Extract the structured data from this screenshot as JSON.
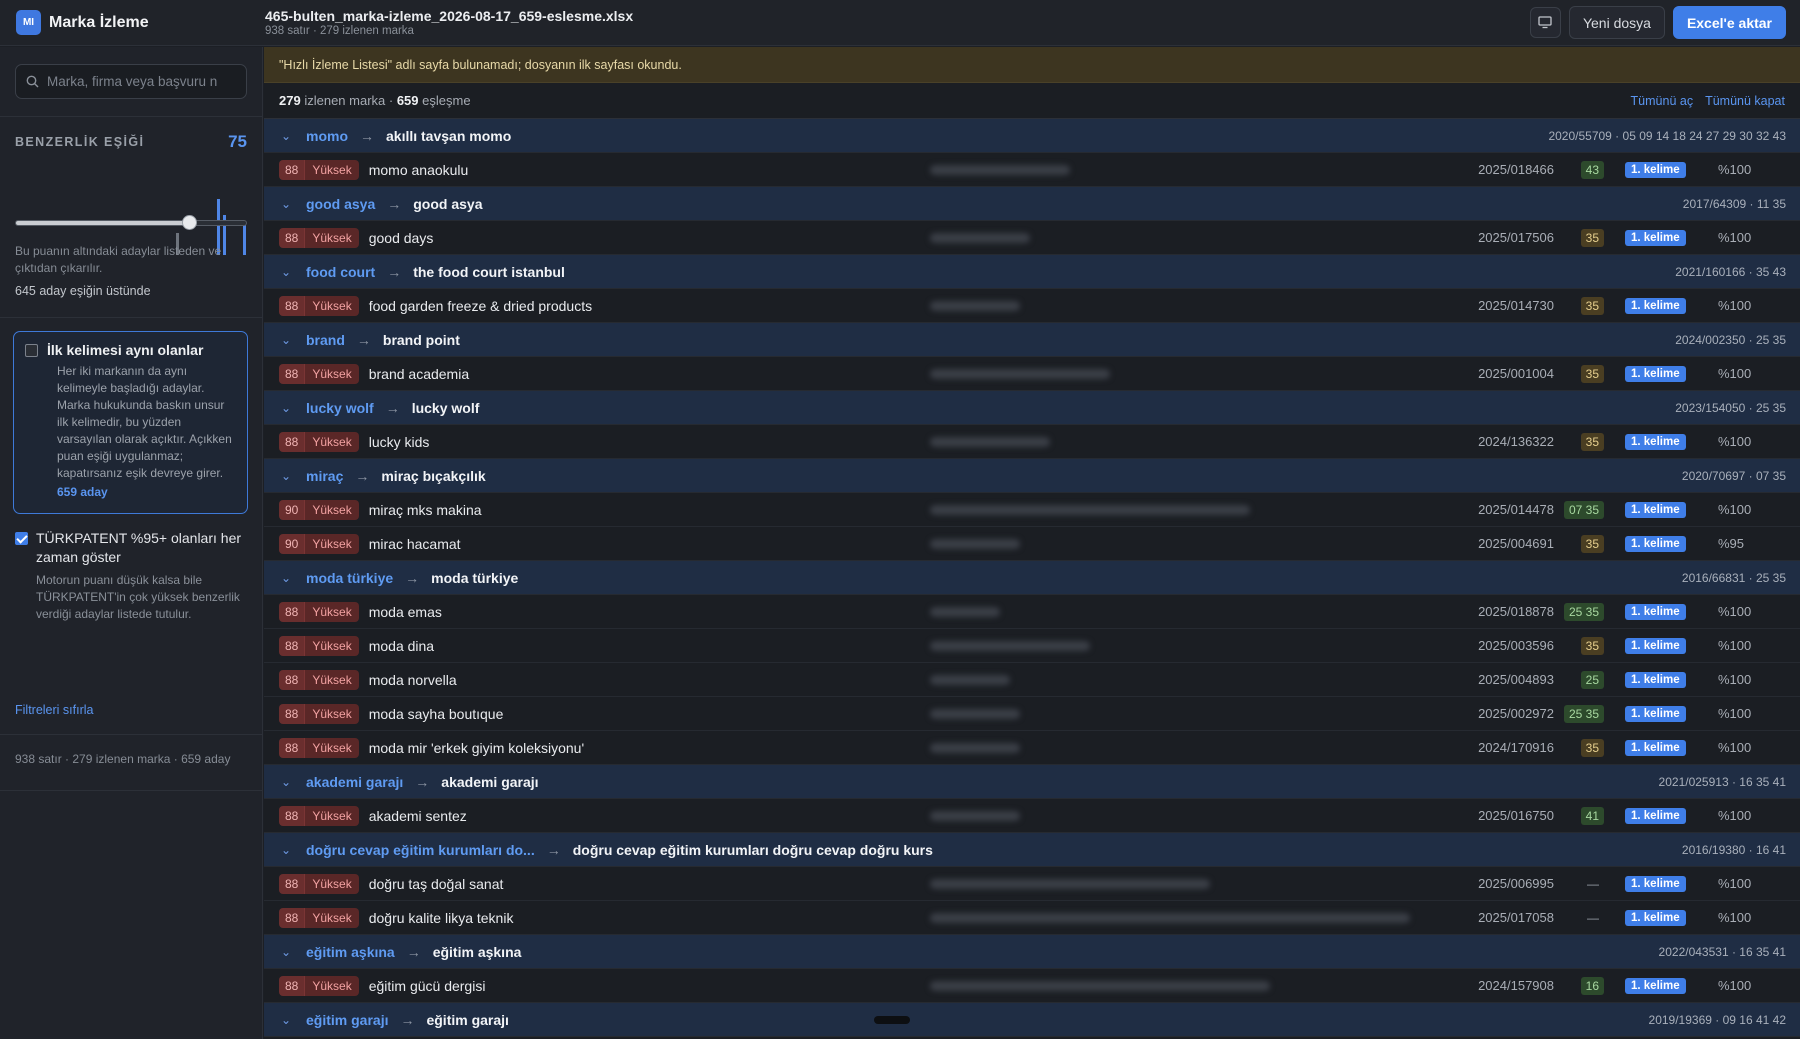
{
  "app": {
    "badge": "MI",
    "title": "Marka İzleme"
  },
  "file": {
    "name": "465-bulten_marka-izleme_2026-08-17_659-eslesme.xlsx",
    "meta": "938 satır · 279 izlenen marka"
  },
  "toolbar": {
    "new_file": "Yeni dosya",
    "export": "Excel'e aktar"
  },
  "sidebar": {
    "search_placeholder": "Marka, firma veya başvuru n",
    "threshold_label": "BENZERLİK EŞİĞİ",
    "threshold_value": "75",
    "threshold_level": 75,
    "help_text": "Bu puanın altındaki adaylar listeden ve çıktıdan çıkarılır.",
    "above_threshold": "645 aday eşiğin üstünde",
    "first_word": {
      "title": "İlk kelimesi aynı olanlar",
      "desc": "Her iki markanın da aynı kelimeyle başladığı adaylar. Marka hukukunda baskın unsur ilk kelimedir, bu yüzden varsayılan olarak açıktır. Açıkken puan eşiği uygulanmaz; kapatırsanız eşik devreye girer.",
      "count": "659 aday",
      "checked": false
    },
    "turkpatent": {
      "title": "TÜRKPATENT %95+ olanları her zaman göster",
      "desc": "Motorun puanı düşük kalsa bile TÜRKPATENT'in çok yüksek benzerlik verdiği adaylar listede tutulur.",
      "checked": true
    },
    "reset": "Filtreleri sıfırla",
    "footer": "938 satır · 279 izlenen marka · 659 aday"
  },
  "main": {
    "banner": "\"Hızlı İzleme Listesi\" adlı sayfa bulunamadı; dosyanın ilk sayfası okundu.",
    "summary": {
      "watched_count": "279",
      "watched_label": "izlenen marka ·",
      "match_count": "659",
      "match_label": "eşleşme"
    },
    "expand_all": "Tümünü aç",
    "collapse_all": "Tümünü kapat",
    "level_label": "Yüksek",
    "word_badge": "1. kelime",
    "groups": [
      {
        "source": "momo",
        "target": "akıllı tavşan momo",
        "meta": "2020/55709 · 05 09 14 18 24 27 29 30 32 43",
        "candidates": [
          {
            "score": "88",
            "name": "momo anaokulu",
            "app": "2025/018466",
            "cls": "43",
            "cls_color": "green",
            "pct": "%100"
          }
        ]
      },
      {
        "source": "good asya",
        "target": "good asya",
        "meta": "2017/64309 · 11 35",
        "candidates": [
          {
            "score": "88",
            "name": "good days",
            "app": "2025/017506",
            "cls": "35",
            "cls_color": "amber",
            "pct": "%100"
          }
        ]
      },
      {
        "source": "food court",
        "target": "the food court istanbul",
        "meta": "2021/160166 · 35 43",
        "candidates": [
          {
            "score": "88",
            "name": "food garden freeze & dried products",
            "app": "2025/014730",
            "cls": "35",
            "cls_color": "amber",
            "pct": "%100"
          }
        ]
      },
      {
        "source": "brand",
        "target": "brand point",
        "meta": "2024/002350 · 25 35",
        "candidates": [
          {
            "score": "88",
            "name": "brand academia",
            "app": "2025/001004",
            "cls": "35",
            "cls_color": "amber",
            "pct": "%100"
          }
        ]
      },
      {
        "source": "lucky wolf",
        "target": "lucky wolf",
        "meta": "2023/154050 · 25 35",
        "candidates": [
          {
            "score": "88",
            "name": "lucky kids",
            "app": "2024/136322",
            "cls": "35",
            "cls_color": "amber",
            "pct": "%100"
          }
        ]
      },
      {
        "source": "miraç",
        "target": "miraç bıçakçılık",
        "meta": "2020/70697 · 07 35",
        "candidates": [
          {
            "score": "90",
            "name": "miraç mks makina",
            "app": "2025/014478",
            "cls": "07 35",
            "cls_color": "green",
            "pct": "%100"
          },
          {
            "score": "90",
            "name": "mirac hacamat",
            "app": "2025/004691",
            "cls": "35",
            "cls_color": "amber",
            "pct": "%95"
          }
        ]
      },
      {
        "source": "moda türkiye",
        "target": "moda türkiye",
        "meta": "2016/66831 · 25 35",
        "candidates": [
          {
            "score": "88",
            "name": "moda emas",
            "app": "2025/018878",
            "cls": "25 35",
            "cls_color": "green",
            "pct": "%100"
          },
          {
            "score": "88",
            "name": "moda dina",
            "app": "2025/003596",
            "cls": "35",
            "cls_color": "amber",
            "pct": "%100"
          },
          {
            "score": "88",
            "name": "moda norvella",
            "app": "2025/004893",
            "cls": "25",
            "cls_color": "green",
            "pct": "%100"
          },
          {
            "score": "88",
            "name": "moda sayha boutıque",
            "app": "2025/002972",
            "cls": "25 35",
            "cls_color": "green",
            "pct": "%100"
          },
          {
            "score": "88",
            "name": "moda mir 'erkek giyim koleksiyonu'",
            "app": "2024/170916",
            "cls": "35",
            "cls_color": "amber",
            "pct": "%100"
          }
        ]
      },
      {
        "source": "akademi garajı",
        "target": "akademi garajı",
        "meta": "2021/025913 · 16 35 41",
        "candidates": [
          {
            "score": "88",
            "name": "akademi sentez",
            "app": "2025/016750",
            "cls": "41",
            "cls_color": "green",
            "pct": "%100"
          }
        ]
      },
      {
        "source": "doğru cevap eğitim kurumları do...",
        "target": "doğru cevap eğitim kurumları doğru cevap doğru kurs",
        "meta": "2016/19380 · 16 41",
        "candidates": [
          {
            "score": "88",
            "name": "doğru taş doğal sanat",
            "app": "2025/006995",
            "cls": "—",
            "cls_color": "dash",
            "pct": "%100"
          },
          {
            "score": "88",
            "name": "doğru kalite likya teknik",
            "app": "2025/017058",
            "cls": "—",
            "cls_color": "dash",
            "pct": "%100"
          }
        ]
      },
      {
        "source": "eğitim aşkına",
        "target": "eğitim aşkına",
        "meta": "2022/043531 · 16 35 41",
        "candidates": [
          {
            "score": "88",
            "name": "eğitim gücü dergisi",
            "app": "2024/157908",
            "cls": "16",
            "cls_color": "green",
            "pct": "%100"
          }
        ]
      },
      {
        "source": "eğitim garajı",
        "target": "eğitim garajı",
        "meta": "2019/19369 · 09 16 41 42",
        "candidates": []
      }
    ]
  }
}
